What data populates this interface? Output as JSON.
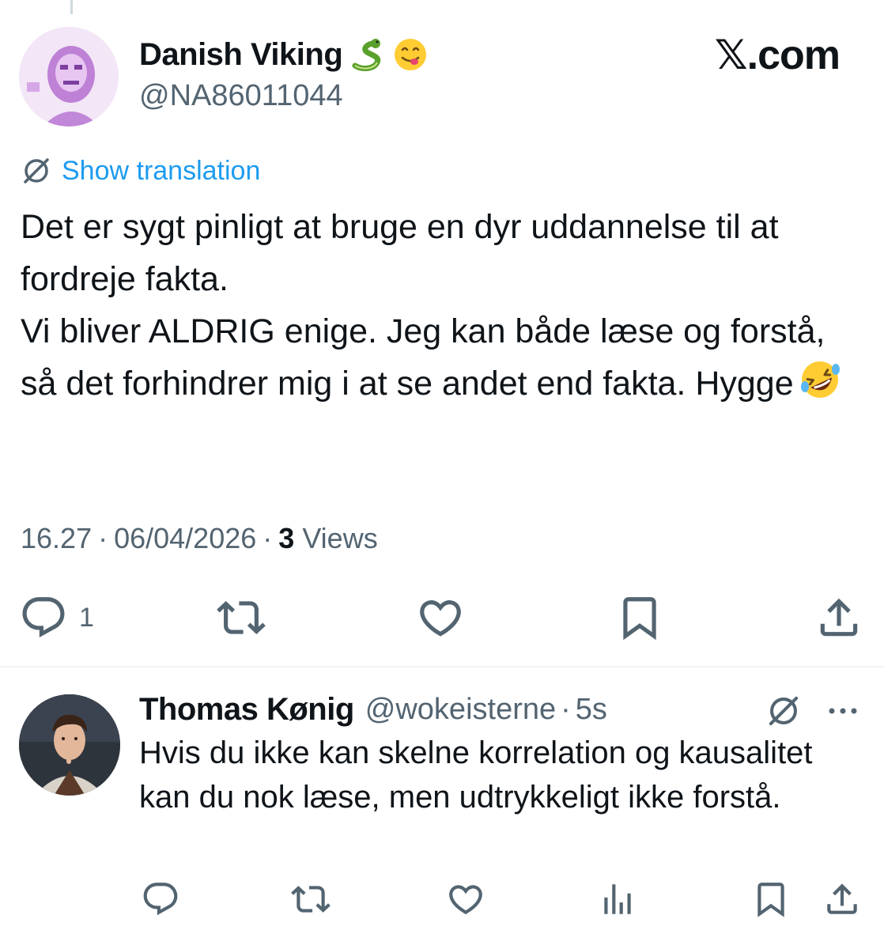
{
  "main_tweet": {
    "display_name": "Danish Viking",
    "name_emojis": [
      "snake-emoji",
      "yum-emoji"
    ],
    "handle": "@NA86011044",
    "brand": "𝕏.com",
    "show_translation": "Show translation",
    "body": "Det er sygt pinligt at bruge en dyr uddannelse til at fordreje fakta.\nVi bliver ALDRIG enige. Jeg kan både læse og forstå, så det forhindrer mig i at se andet end fakta. Hygge",
    "body_emoji": "rofl-emoji",
    "time": "16.27",
    "date": "06/04/2026",
    "views_count": "3",
    "views_label": "Views",
    "separator": "·",
    "actions": {
      "reply_count": "1"
    }
  },
  "reply_tweet": {
    "display_name": "Thomas Kønig",
    "handle": "@wokeisterne",
    "separator": "·",
    "time": "5s",
    "body": "Hvis du ikke kan skelne korrelation og kausalitet kan du nok læse, men udtrykkeligt ikke forstå."
  },
  "colors": {
    "accent": "#1d9bf0",
    "icon_gray": "#536471",
    "text": "#0f1419",
    "divider": "#eff3f4"
  },
  "icons": [
    "translate-icon",
    "reply-icon",
    "retweet-icon",
    "like-icon",
    "bookmark-icon",
    "share-icon",
    "views-chart-icon",
    "more-icon"
  ]
}
